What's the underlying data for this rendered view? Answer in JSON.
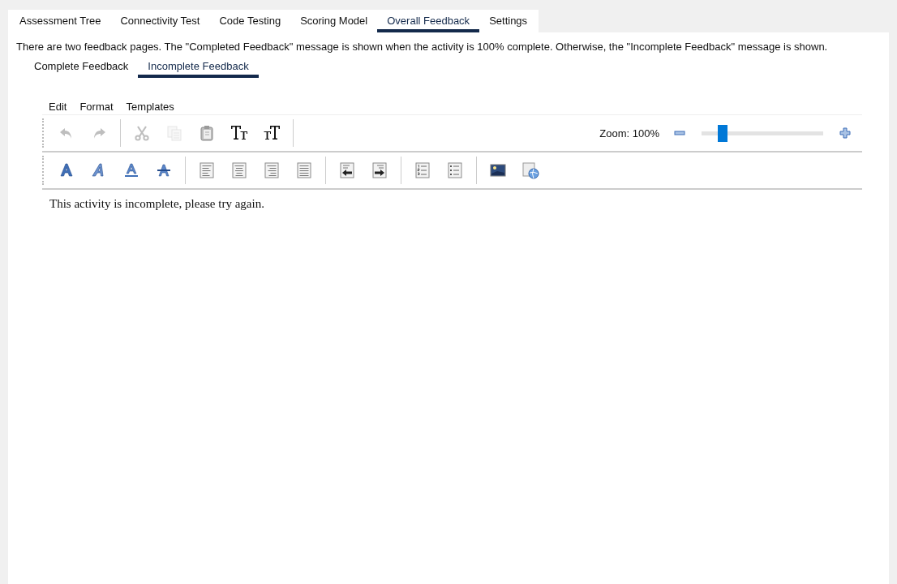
{
  "tabs": [
    {
      "label": "Assessment Tree",
      "selected": false
    },
    {
      "label": "Connectivity Test",
      "selected": false
    },
    {
      "label": "Code Testing",
      "selected": false
    },
    {
      "label": "Scoring Model",
      "selected": false
    },
    {
      "label": "Overall Feedback",
      "selected": true
    },
    {
      "label": "Settings",
      "selected": false
    }
  ],
  "description": "There are two feedback pages. The \"Completed Feedback\" message is shown when the activity is 100% complete. Otherwise, the \"Incomplete Feedback\" message is shown.",
  "feedback_tabs": [
    {
      "label": "Complete Feedback",
      "selected": false
    },
    {
      "label": "Incomplete Feedback",
      "selected": true
    }
  ],
  "editor": {
    "menu": [
      "Edit",
      "Format",
      "Templates"
    ],
    "toolbar_1": [
      {
        "kind": "undo",
        "disabled": true
      },
      {
        "kind": "redo",
        "disabled": true
      },
      {
        "kind": "separator"
      },
      {
        "kind": "cut",
        "disabled": true
      },
      {
        "kind": "copy",
        "disabled": true
      },
      {
        "kind": "paste",
        "disabled": false
      },
      {
        "kind": "font-larger",
        "disabled": false
      },
      {
        "kind": "font-smaller",
        "disabled": false
      },
      {
        "kind": "separator"
      }
    ],
    "zoom": {
      "label": "Zoom: 100%",
      "level": 0.17
    },
    "toolbar_2": [
      {
        "kind": "bold"
      },
      {
        "kind": "italic"
      },
      {
        "kind": "underline"
      },
      {
        "kind": "strike"
      },
      {
        "kind": "separator"
      },
      {
        "kind": "align-left"
      },
      {
        "kind": "align-center"
      },
      {
        "kind": "align-right"
      },
      {
        "kind": "justify"
      },
      {
        "kind": "separator"
      },
      {
        "kind": "outdent"
      },
      {
        "kind": "indent"
      },
      {
        "kind": "separator"
      },
      {
        "kind": "numbered-list"
      },
      {
        "kind": "bulleted-list"
      },
      {
        "kind": "separator"
      },
      {
        "kind": "image"
      },
      {
        "kind": "web-link"
      }
    ],
    "content": "This activity is incomplete, please try again."
  }
}
